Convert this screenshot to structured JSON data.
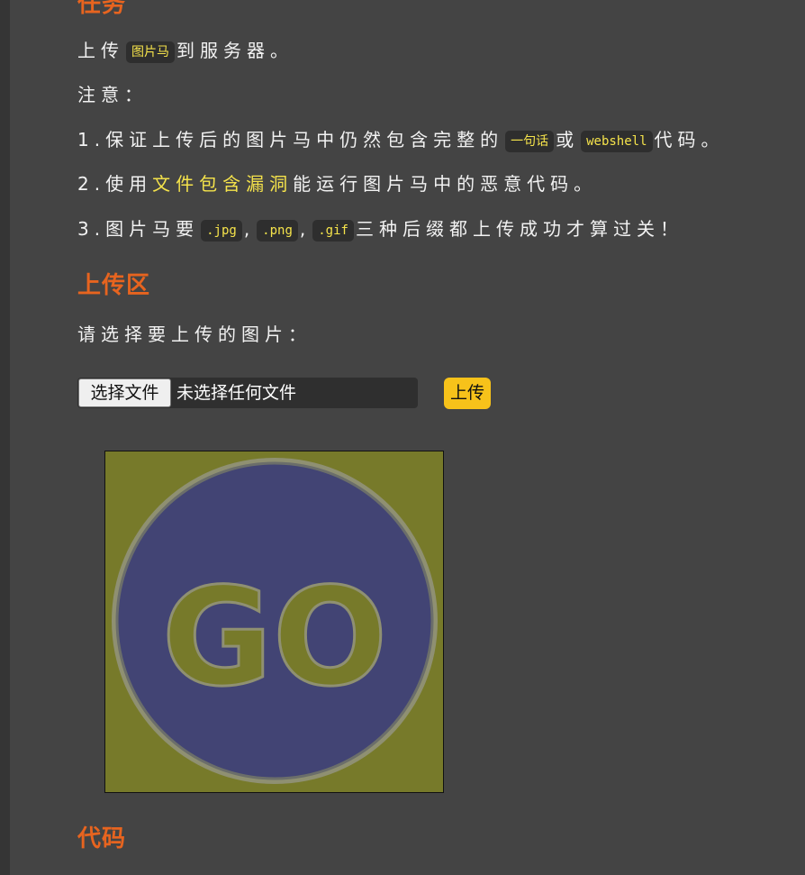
{
  "task_section": {
    "title": "任务",
    "line1": {
      "before": "上传",
      "code": "图片马",
      "after": "到服务器。"
    },
    "note_label": "注意：",
    "item1": {
      "before": "1.保证上传后的图片马中仍然包含完整的",
      "code1": "一句话",
      "middle": "或",
      "code2": "webshell",
      "after": "代码。"
    },
    "item2": {
      "before": "2.使用",
      "highlight": "文件包含漏洞",
      "after": "能运行图片马中的恶意代码。"
    },
    "item3": {
      "before": "3.图片马要",
      "code1": ".jpg",
      "sep1": ",",
      "code2": ".png",
      "sep2": ",",
      "code3": ".gif",
      "after": "三种后缀都上传成功才算过关！"
    }
  },
  "upload_section": {
    "title": "上传区",
    "prompt": "请选择要上传的图片：",
    "choose_button": "选择文件",
    "file_status": "未选择任何文件",
    "upload_button": "上传",
    "preview_text": "GO"
  },
  "code_section": {
    "title": "代码"
  },
  "colors": {
    "background": "#444444",
    "heading": "#e7641f",
    "highlight": "#f5e34b",
    "upload_button": "#f7c21a",
    "preview_bg": "#777a2a",
    "preview_circle": "#424474"
  }
}
